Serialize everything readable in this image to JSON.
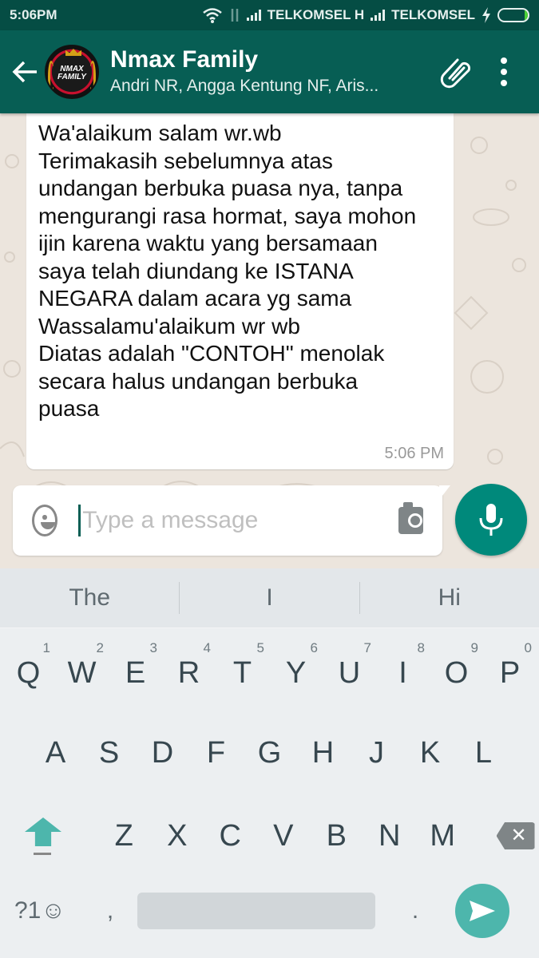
{
  "status_bar": {
    "time": "5:06PM",
    "carrier1": "TELKOMSEL H",
    "carrier2": "TELKOMSEL",
    "battery_level": 0.12,
    "icons": [
      "wifi-icon",
      "data-transfer-icon",
      "signal-icon",
      "signal-icon",
      "charging-icon",
      "battery-icon"
    ]
  },
  "app_bar": {
    "back_icon": "arrow-left-icon",
    "title": "Nmax Family",
    "subtitle": "Andri NR, Angga Kentung NF, Aris...",
    "avatar_text": "NMAX FAMILY",
    "actions": [
      "paperclip-icon",
      "more-vert-icon"
    ]
  },
  "chat": {
    "message": {
      "lines": [
        "Wa'alaikum salam wr.wb",
        "Terimakasih sebelumnya atas",
        "undangan berbuka puasa nya, tanpa",
        "mengurangi rasa hormat, saya mohon",
        "ijin karena waktu yang bersamaan",
        "saya telah diundang ke ISTANA",
        "NEGARA dalam acara yg sama",
        "Wassalamu'alaikum wr wb",
        "",
        "Diatas adalah \"CONTOH\" menolak",
        "secara halus undangan berbuka",
        "puasa"
      ],
      "time": "5:06 PM"
    }
  },
  "composer": {
    "placeholder": "Type a message",
    "value": "",
    "emoji_icon": "emoji-icon",
    "camera_icon": "camera-icon",
    "mic_icon": "mic-icon"
  },
  "keyboard": {
    "suggestions": [
      "The",
      "I",
      "Hi"
    ],
    "row1": [
      {
        "key": "Q",
        "hint": "1"
      },
      {
        "key": "W",
        "hint": "2"
      },
      {
        "key": "E",
        "hint": "3"
      },
      {
        "key": "R",
        "hint": "4"
      },
      {
        "key": "T",
        "hint": "5"
      },
      {
        "key": "Y",
        "hint": "6"
      },
      {
        "key": "U",
        "hint": "7"
      },
      {
        "key": "I",
        "hint": "8"
      },
      {
        "key": "O",
        "hint": "9"
      },
      {
        "key": "P",
        "hint": "0"
      }
    ],
    "row2": [
      "A",
      "S",
      "D",
      "F",
      "G",
      "H",
      "J",
      "K",
      "L"
    ],
    "row3": [
      "Z",
      "X",
      "C",
      "V",
      "B",
      "N",
      "M"
    ],
    "backspace_glyph": "✕",
    "symbols_label": "?1☺",
    "comma": ",",
    "period": "."
  }
}
